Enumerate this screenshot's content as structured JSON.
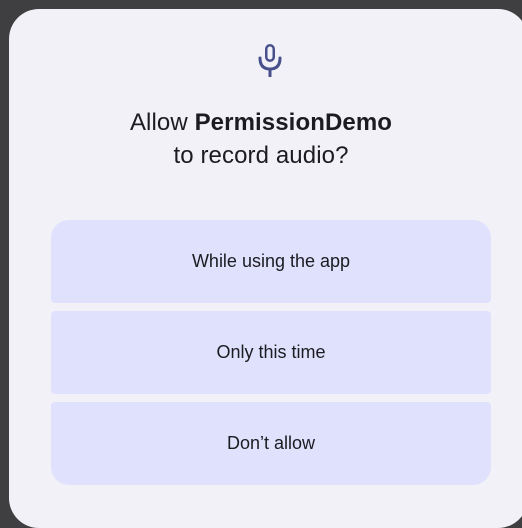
{
  "dialog": {
    "icon": "microphone-icon",
    "title_prefix": "Allow ",
    "app_name": "PermissionDemo",
    "title_suffix": " to record audio?",
    "options": [
      {
        "label": "While using the app"
      },
      {
        "label": "Only this time"
      },
      {
        "label": "Don’t allow"
      }
    ],
    "colors": {
      "icon": "#48508c",
      "button_bg": "#dfe1fd",
      "dialog_bg": "#f2f1f7",
      "backdrop": "#3f3f41"
    }
  }
}
